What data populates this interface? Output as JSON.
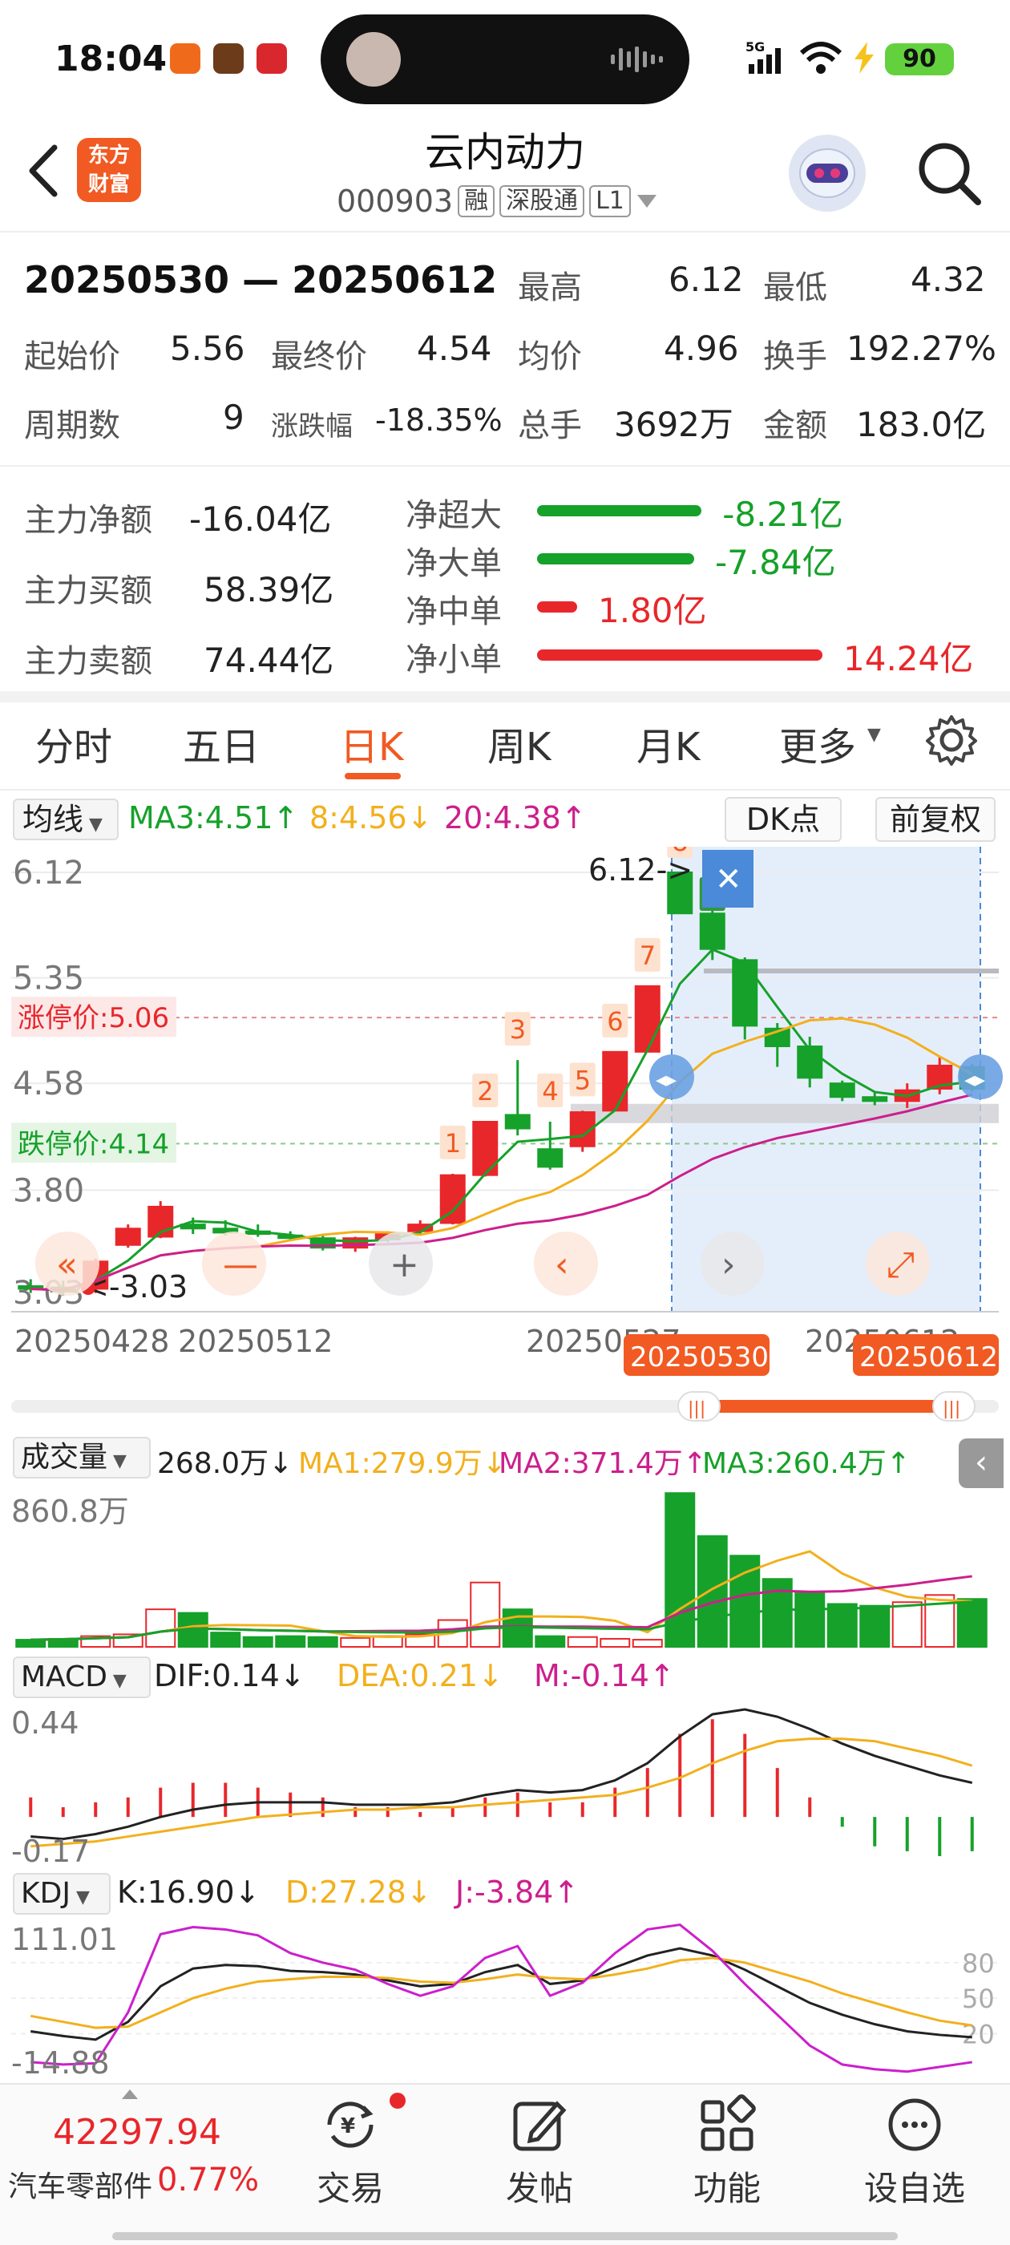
{
  "status_bar": {
    "time": "18:04",
    "battery": "90",
    "network": "5G"
  },
  "header": {
    "stock_name": "云内动力",
    "stock_code": "000903",
    "tags": [
      "融",
      "深股通",
      "L1"
    ],
    "logo_text_1": "东方",
    "logo_text_2": "财富"
  },
  "range": {
    "period": "20250530 — 20250612",
    "high_label": "最高",
    "high": "6.12",
    "low_label": "最低",
    "low": "4.32",
    "open_label": "起始价",
    "open": "5.56",
    "close_label": "最终价",
    "close": "4.54",
    "avg_label": "均价",
    "avg": "4.96",
    "turnover_label": "换手",
    "turnover": "192.27%",
    "periods_label": "周期数",
    "periods": "9",
    "change_label": "涨跌幅",
    "change": "-18.35%",
    "volume_label": "总手",
    "volume": "3692万",
    "amount_label": "金额",
    "amount": "183.0亿"
  },
  "fund_flow": {
    "main_net_label": "主力净额",
    "main_net": "-16.04亿",
    "main_buy_label": "主力买额",
    "main_buy": "58.39亿",
    "main_sell_label": "主力卖额",
    "main_sell": "74.44亿",
    "bars": [
      {
        "label": "净超大",
        "value": "-8.21亿",
        "amount": -8.21,
        "color": "#16a12a"
      },
      {
        "label": "净大单",
        "value": "-7.84亿",
        "amount": -7.84,
        "color": "#16a12a"
      },
      {
        "label": "净中单",
        "value": "1.80亿",
        "amount": 1.8,
        "color": "#e8272b"
      },
      {
        "label": "净小单",
        "value": "14.24亿",
        "amount": 14.24,
        "color": "#e8272b"
      }
    ]
  },
  "tabs": [
    "分时",
    "五日",
    "日K",
    "周K",
    "月K",
    "更多"
  ],
  "active_tab": "日K",
  "kline": {
    "ma_selector": "均线",
    "ma3": "MA3:4.51",
    "ma8": "8:4.56",
    "ma20": "20:4.38",
    "dk_button": "DK点",
    "adjust_button": "前复权",
    "price_labels": [
      "6.12",
      "5.35",
      "4.58",
      "3.80",
      "3.03"
    ],
    "limit_up_label": "涨停价:5.06",
    "limit_down_label": "跌停价:4.14",
    "max_marker": "6.12->",
    "min_marker": "<-3.03",
    "date_labels": [
      "20250428",
      "20250512",
      "20250527",
      "20250612"
    ],
    "range_start": "20250530",
    "range_end": "20250612",
    "board_count_badges": [
      "1",
      "2",
      "3",
      "4",
      "5",
      "6",
      "7",
      "8",
      "9"
    ],
    "chart_data": {
      "type": "candlestick",
      "ylim": [
        3.03,
        6.12
      ],
      "candles": [
        {
          "o": 3.1,
          "h": 3.15,
          "l": 3.05,
          "c": 3.08
        },
        {
          "o": 3.09,
          "h": 3.14,
          "l": 3.03,
          "c": 3.06
        },
        {
          "o": 3.08,
          "h": 3.3,
          "l": 3.05,
          "c": 3.28
        },
        {
          "o": 3.4,
          "h": 3.55,
          "l": 3.38,
          "c": 3.52
        },
        {
          "o": 3.46,
          "h": 3.72,
          "l": 3.45,
          "c": 3.68
        },
        {
          "o": 3.55,
          "h": 3.6,
          "l": 3.48,
          "c": 3.52
        },
        {
          "o": 3.52,
          "h": 3.58,
          "l": 3.47,
          "c": 3.49
        },
        {
          "o": 3.5,
          "h": 3.55,
          "l": 3.46,
          "c": 3.48
        },
        {
          "o": 3.47,
          "h": 3.5,
          "l": 3.43,
          "c": 3.45
        },
        {
          "o": 3.45,
          "h": 3.48,
          "l": 3.36,
          "c": 3.38
        },
        {
          "o": 3.38,
          "h": 3.46,
          "l": 3.35,
          "c": 3.45
        },
        {
          "o": 3.44,
          "h": 3.5,
          "l": 3.42,
          "c": 3.48
        },
        {
          "o": 3.5,
          "h": 3.58,
          "l": 3.48,
          "c": 3.55
        },
        {
          "o": 3.56,
          "h": 3.92,
          "l": 3.55,
          "c": 3.91
        },
        {
          "o": 3.91,
          "h": 4.3,
          "l": 3.9,
          "c": 4.3
        },
        {
          "o": 4.35,
          "h": 4.75,
          "l": 4.2,
          "c": 4.25
        },
        {
          "o": 4.1,
          "h": 4.3,
          "l": 3.95,
          "c": 3.97
        },
        {
          "o": 4.12,
          "h": 4.38,
          "l": 4.08,
          "c": 4.37
        },
        {
          "o": 4.38,
          "h": 4.81,
          "l": 4.38,
          "c": 4.81
        },
        {
          "o": 4.81,
          "h": 5.29,
          "l": 4.81,
          "c": 5.29
        },
        {
          "o": 6.12,
          "h": 6.12,
          "l": 5.82,
          "c": 5.82
        },
        {
          "o": 5.82,
          "h": 6.12,
          "l": 5.48,
          "c": 5.56
        },
        {
          "o": 5.48,
          "h": 5.5,
          "l": 4.9,
          "c": 5.0
        },
        {
          "o": 4.98,
          "h": 5.02,
          "l": 4.7,
          "c": 4.85
        },
        {
          "o": 4.85,
          "h": 4.92,
          "l": 4.55,
          "c": 4.62
        },
        {
          "o": 4.58,
          "h": 4.6,
          "l": 4.45,
          "c": 4.48
        },
        {
          "o": 4.48,
          "h": 4.52,
          "l": 4.42,
          "c": 4.45
        },
        {
          "o": 4.45,
          "h": 4.58,
          "l": 4.4,
          "c": 4.53
        },
        {
          "o": 4.54,
          "h": 4.78,
          "l": 4.5,
          "c": 4.71
        },
        {
          "o": 4.7,
          "h": 4.72,
          "l": 4.52,
          "c": 4.54
        }
      ]
    }
  },
  "volume": {
    "selector": "成交量",
    "current": "268.0万",
    "ma1": "MA1:279.9万",
    "ma2": "MA2:371.4万",
    "ma3": "MA3:260.4万",
    "max_label": "860.8万",
    "chart_data": {
      "type": "bar",
      "values": [
        40,
        45,
        60,
        70,
        210,
        190,
        80,
        55,
        60,
        55,
        50,
        60,
        70,
        150,
        360,
        210,
        60,
        55,
        45,
        40,
        860,
        620,
        510,
        380,
        300,
        240,
        230,
        250,
        290,
        268
      ]
    }
  },
  "macd": {
    "selector": "MACD",
    "dif": "DIF:0.14",
    "dea": "DEA:0.21",
    "m": "M:-0.14",
    "top_label": "0.44",
    "bottom_label": "-0.17"
  },
  "kdj": {
    "selector": "KDJ",
    "k": "K:16.90",
    "d": "D:27.28",
    "j": "J:-3.84",
    "top_label": "111.01",
    "bottom_label": "-14.88",
    "levels": [
      "80",
      "50",
      "20"
    ]
  },
  "bottom_nav": {
    "index_value": "42297.94",
    "index_name": "汽车零部件",
    "index_change": "0.77%",
    "items": [
      "交易",
      "发帖",
      "功能",
      "设自选"
    ]
  }
}
